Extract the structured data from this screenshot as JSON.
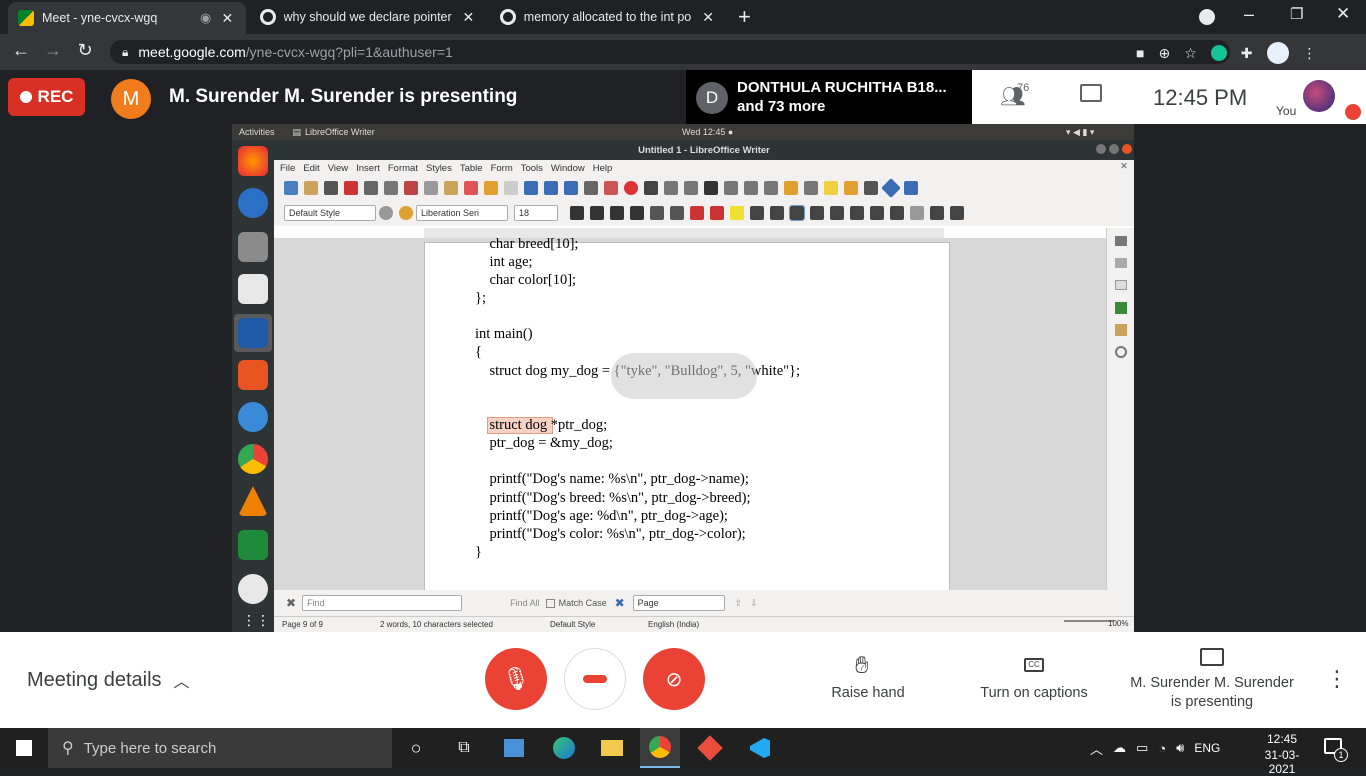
{
  "browser": {
    "tabs": [
      {
        "title": "Meet - yne-cvcx-wgq"
      },
      {
        "title": "why should we declare pointer as"
      },
      {
        "title": "memory allocated to the int poin"
      }
    ],
    "url_host": "meet.google.com",
    "url_path": "/yne-cvcx-wgq?pli=1&authuser=1"
  },
  "meet": {
    "rec_label": "REC",
    "presenter_initial": "M",
    "presenting_text": "M. Surender M. Surender is presenting",
    "participant_initial": "D",
    "participant_name": "DONTHULA RUCHITHA B18...",
    "participant_more": "and 73 more",
    "people_count": "76",
    "clock": "12:45  PM",
    "you_label": "You",
    "meeting_details": "Meeting details",
    "raise_hand": "Raise hand",
    "captions": "Turn on captions",
    "presenting_line1": "M. Surender M. Surender",
    "presenting_line2": "is presenting"
  },
  "ubuntu": {
    "activities": "Activities",
    "app_name": "LibreOffice Writer",
    "datetime": "Wed 12:45 ●"
  },
  "writer": {
    "title": "Untitled 1 - LibreOffice Writer",
    "menu": [
      "File",
      "Edit",
      "View",
      "Insert",
      "Format",
      "Styles",
      "Table",
      "Form",
      "Tools",
      "Window",
      "Help"
    ],
    "para_style": "Default Style",
    "font_name": "Liberation Seri",
    "font_size": "18",
    "code_lines": [
      "    char breed[10];",
      "    int age;",
      "    char color[10];",
      "};",
      "",
      "int main()",
      "{",
      "    struct dog my_dog = {\"tyke\", \"Bulldog\", 5, \"white\"};",
      "",
      "",
      "    struct dog *ptr_dog;",
      "    ptr_dog = &my_dog;",
      "",
      "    printf(\"Dog's name: %s\\n\", ptr_dog->name);",
      "    printf(\"Dog's breed: %s\\n\", ptr_dog->breed);",
      "    printf(\"Dog's age: %d\\n\", ptr_dog->age);",
      "    printf(\"Dog's color: %s\\n\", ptr_dog->color);",
      "}"
    ],
    "highlighted_text": "struct dog",
    "find_placeholder": "Find",
    "find_all": "Find All",
    "match_case": "Match Case",
    "page_combo": "Page",
    "status": {
      "page": "Page 9 of 9",
      "words": "2 words, 10 characters selected",
      "style": "Default Style",
      "lang": "English (India)",
      "zoom": "100%"
    }
  },
  "taskbar": {
    "search_placeholder": "Type here to search",
    "lang": "ENG",
    "time": "12:45",
    "date": "31-03-2021",
    "notif_count": "1"
  },
  "colors": {
    "rec_red": "#d93025",
    "presenter_orange": "#f07c1b",
    "meet_red": "#ea4335"
  }
}
